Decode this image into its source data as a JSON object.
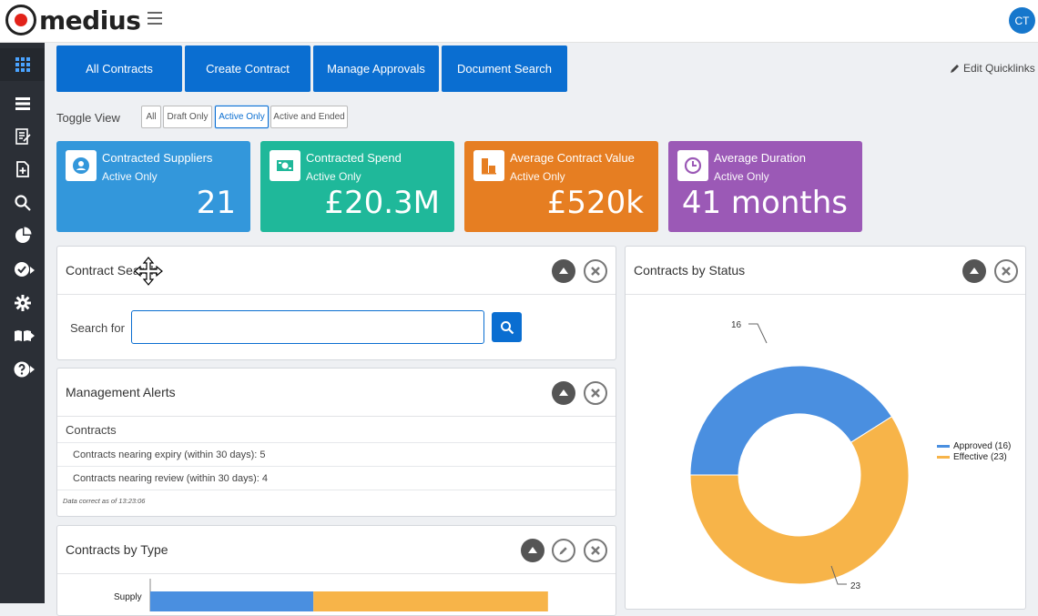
{
  "header": {
    "logo_text": "medius",
    "user_initials": "CT"
  },
  "sidebar": {
    "items": [
      "dashboard-grid",
      "list",
      "contract-edit",
      "add-document",
      "search",
      "pie-chart",
      "approve-check",
      "settings-gear",
      "library-books",
      "help"
    ]
  },
  "quicklinks": {
    "items": [
      "All Contracts",
      "Create Contract",
      "Manage Approvals",
      "Document Search"
    ],
    "edit_label": "Edit Quicklinks"
  },
  "toggle": {
    "label": "Toggle View",
    "options": [
      "All",
      "Draft Only",
      "Active Only",
      "Active and Ended"
    ],
    "selected": "Active Only"
  },
  "kpis": [
    {
      "title": "Contracted Suppliers",
      "sub": "Active Only",
      "value": "21",
      "color": "#3397db",
      "icon": "supplier-icon"
    },
    {
      "title": "Contracted Spend",
      "sub": "Active Only",
      "value": "£20.3M",
      "color": "#1fb89a",
      "icon": "money-icon"
    },
    {
      "title": "Average Contract Value",
      "sub": "Active Only",
      "value": "£520k",
      "color": "#e67e22",
      "icon": "value-chart-icon"
    },
    {
      "title": "Average Duration",
      "sub": "Active Only",
      "value": "41 months",
      "color": "#9b59b6",
      "icon": "clock-icon"
    }
  ],
  "contract_search": {
    "title": "Contract Search",
    "search_label": "Search for",
    "input_value": ""
  },
  "alerts": {
    "title": "Management Alerts",
    "section": "Contracts",
    "rows": [
      "Contracts nearing expiry (within 30 days): 5",
      "Contracts nearing review (within 30 days): 4"
    ],
    "note": "Data correct as of 13:23:06"
  },
  "contracts_by_type": {
    "title": "Contracts by Type"
  },
  "contracts_by_status": {
    "title": "Contracts by Status"
  },
  "chart_data": [
    {
      "type": "pie",
      "title": "Contracts by Status",
      "categories": [
        "Approved",
        "Effective"
      ],
      "values": [
        16,
        23
      ],
      "data_labels": [
        "16",
        "23"
      ],
      "legend": [
        "Approved (16)",
        "Effective (23)"
      ],
      "legend_position": "right",
      "colors": [
        "#4a8fe0",
        "#f7b449"
      ]
    },
    {
      "type": "bar",
      "title": "Contracts by Type",
      "categories": [
        "Supply"
      ],
      "series": [
        {
          "values": [
            16
          ],
          "color": "#4a8fe0"
        },
        {
          "values": [
            23
          ],
          "color": "#f7b449"
        }
      ]
    }
  ]
}
